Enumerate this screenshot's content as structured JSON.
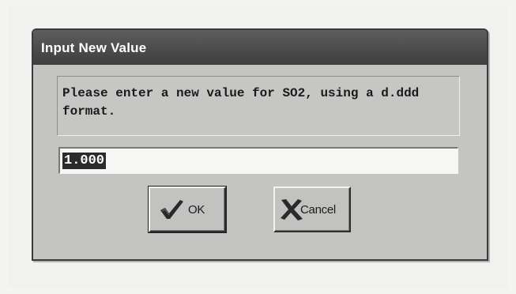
{
  "dialog": {
    "title": "Input New Value",
    "message": "Please enter a new value for SO2, using a d.ddd format.",
    "input": {
      "value": "1.000",
      "selected": true
    },
    "buttons": {
      "ok": {
        "label": "OK",
        "icon": "checkmark-icon"
      },
      "cancel": {
        "label": "Cancel",
        "icon": "x-cross-icon"
      }
    },
    "colors": {
      "titlebar": "#4a4a4a",
      "body": "#c4c4c2",
      "selection": "#2b2b2b"
    }
  }
}
